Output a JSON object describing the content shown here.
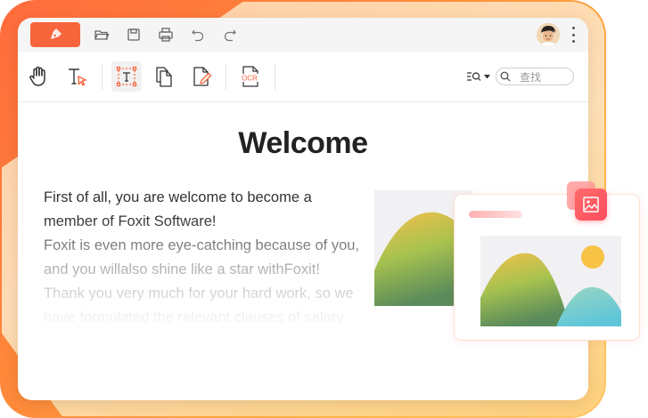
{
  "search": {
    "placeholder": "查找"
  },
  "document": {
    "title": "Welcome",
    "lines": [
      "First of all, you are welcome to become a",
      "member of Foxit Software!",
      "Foxit is even more eye-catching because of you,",
      "and you willalso shine like a star withFoxit!",
      "Thank you very much for your hard work, so we",
      "have formulated the relevant clauses of salary"
    ]
  },
  "icons": {
    "titlebar": [
      "brand-pen-icon",
      "folder-open-icon",
      "save-icon",
      "print-icon",
      "undo-icon",
      "redo-icon"
    ],
    "toolbar": [
      "hand-tool-icon",
      "text-select-icon",
      "text-box-icon",
      "copy-pages-icon",
      "edit-document-icon",
      "ocr-icon",
      "find-options-icon",
      "search-icon"
    ]
  },
  "colors": {
    "accent": "#f7653c",
    "frame_start": "#ff6b3d",
    "frame_end": "#ffc86a",
    "badge": "#ff4e5e"
  }
}
